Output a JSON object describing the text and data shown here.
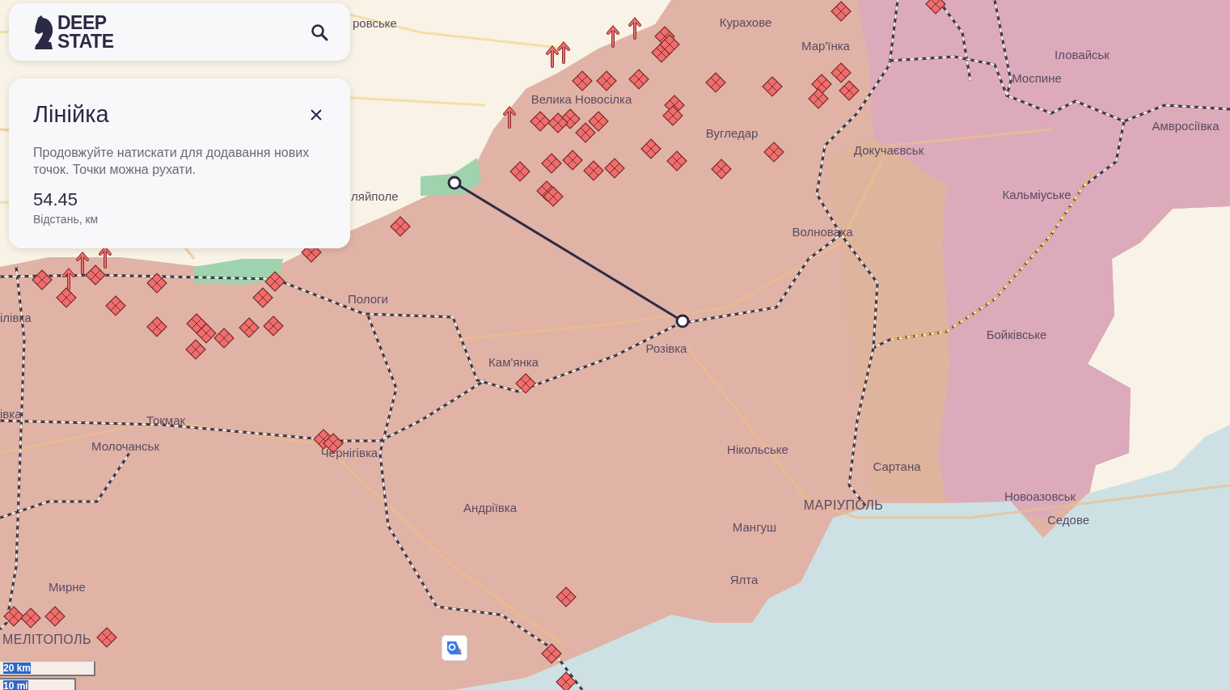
{
  "header": {
    "logo_line1": "DEEP",
    "logo_line2": "STATE"
  },
  "ruler": {
    "title": "Лінійка",
    "hint": "Продовжуйте натискати для додавання нових точок. Точки можна рухати.",
    "distance": "54.45",
    "distance_label": "Відстань, км"
  },
  "map_labels": [
    {
      "text": "ровське",
      "kind": "town"
    },
    {
      "text": "Курахове",
      "kind": "town"
    },
    {
      "text": "Мар'їнка",
      "kind": "town"
    },
    {
      "text": "Іловайськ",
      "kind": "town"
    },
    {
      "text": "Моспине",
      "kind": "town"
    },
    {
      "text": "Велика Новосілка",
      "kind": "town"
    },
    {
      "text": "Амвросіївка",
      "kind": "town"
    },
    {
      "text": "Вугледар",
      "kind": "town"
    },
    {
      "text": "Докучаєвськ",
      "kind": "town"
    },
    {
      "text": "ляйполе",
      "kind": "town"
    },
    {
      "text": "Кальміуське",
      "kind": "town"
    },
    {
      "text": "Волноваха",
      "kind": "town"
    },
    {
      "text": "Пологи",
      "kind": "town"
    },
    {
      "text": "ілівка",
      "kind": "town"
    },
    {
      "text": "Бойківське",
      "kind": "town"
    },
    {
      "text": "Розівка",
      "kind": "town"
    },
    {
      "text": "Кам'янка",
      "kind": "town"
    },
    {
      "text": "івка",
      "kind": "town"
    },
    {
      "text": "Токмак",
      "kind": "town"
    },
    {
      "text": "Молочанськ",
      "kind": "town"
    },
    {
      "text": "Чернігівка",
      "kind": "town"
    },
    {
      "text": "Нікольське",
      "kind": "town"
    },
    {
      "text": "Сартана",
      "kind": "town"
    },
    {
      "text": "Новоазовськ",
      "kind": "town"
    },
    {
      "text": "Андріївка",
      "kind": "town"
    },
    {
      "text": "МАРІУПОЛЬ",
      "kind": "city"
    },
    {
      "text": "Седове",
      "kind": "town"
    },
    {
      "text": "Мангуш",
      "kind": "town"
    },
    {
      "text": "Ялта",
      "kind": "town"
    },
    {
      "text": "Мирне",
      "kind": "town"
    },
    {
      "text": "МЕЛІТОПОЛЬ",
      "kind": "city"
    }
  ],
  "scale": [
    "20 km",
    "10 mi"
  ]
}
